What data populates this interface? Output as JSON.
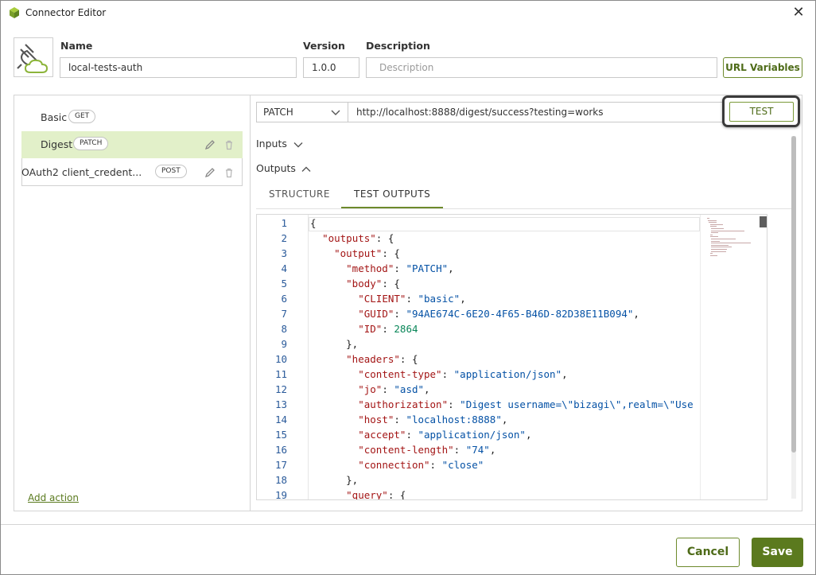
{
  "window": {
    "title": "Connector Editor"
  },
  "header": {
    "name_label": "Name",
    "name_value": "local-tests-auth",
    "version_label": "Version",
    "version_value": "1.0.0",
    "description_label": "Description",
    "description_placeholder": "Description",
    "url_variables_label": "URL Variables"
  },
  "actions": [
    {
      "name": "Basic",
      "method": "GET"
    },
    {
      "name": "Digest",
      "method": "PATCH"
    },
    {
      "name": "OAuth2 client_credent...",
      "method": "POST"
    }
  ],
  "add_action_label": "Add action",
  "request": {
    "method": "PATCH",
    "url": "http://localhost:8888/digest/success?testing=works",
    "test_label": "TEST"
  },
  "sections": {
    "inputs_label": "Inputs",
    "outputs_label": "Outputs"
  },
  "tabs": {
    "structure": "STRUCTURE",
    "test_outputs": "TEST OUTPUTS"
  },
  "editor": {
    "line_numbers": [
      "1",
      "2",
      "3",
      "4",
      "5",
      "6",
      "7",
      "8",
      "9",
      "10",
      "11",
      "12",
      "13",
      "14",
      "15",
      "16",
      "17",
      "18",
      "19"
    ],
    "lines": [
      [
        [
          "p",
          "{"
        ]
      ],
      [
        [
          "p",
          "  "
        ],
        [
          "k",
          "\"outputs\""
        ],
        [
          "p",
          ": {"
        ]
      ],
      [
        [
          "p",
          "    "
        ],
        [
          "k",
          "\"output\""
        ],
        [
          "p",
          ": {"
        ]
      ],
      [
        [
          "p",
          "      "
        ],
        [
          "k",
          "\"method\""
        ],
        [
          "p",
          ": "
        ],
        [
          "s",
          "\"PATCH\""
        ],
        [
          "p",
          ","
        ]
      ],
      [
        [
          "p",
          "      "
        ],
        [
          "k",
          "\"body\""
        ],
        [
          "p",
          ": {"
        ]
      ],
      [
        [
          "p",
          "        "
        ],
        [
          "k",
          "\"CLIENT\""
        ],
        [
          "p",
          ": "
        ],
        [
          "s",
          "\"basic\""
        ],
        [
          "p",
          ","
        ]
      ],
      [
        [
          "p",
          "        "
        ],
        [
          "k",
          "\"GUID\""
        ],
        [
          "p",
          ": "
        ],
        [
          "s",
          "\"94AE674C-6E20-4F65-B46D-82D38E11B094\""
        ],
        [
          "p",
          ","
        ]
      ],
      [
        [
          "p",
          "        "
        ],
        [
          "k",
          "\"ID\""
        ],
        [
          "p",
          ": "
        ],
        [
          "n",
          "2864"
        ]
      ],
      [
        [
          "p",
          "      },"
        ]
      ],
      [
        [
          "p",
          "      "
        ],
        [
          "k",
          "\"headers\""
        ],
        [
          "p",
          ": {"
        ]
      ],
      [
        [
          "p",
          "        "
        ],
        [
          "k",
          "\"content-type\""
        ],
        [
          "p",
          ": "
        ],
        [
          "s",
          "\"application/json\""
        ],
        [
          "p",
          ","
        ]
      ],
      [
        [
          "p",
          "        "
        ],
        [
          "k",
          "\"jo\""
        ],
        [
          "p",
          ": "
        ],
        [
          "s",
          "\"asd\""
        ],
        [
          "p",
          ","
        ]
      ],
      [
        [
          "p",
          "        "
        ],
        [
          "k",
          "\"authorization\""
        ],
        [
          "p",
          ": "
        ],
        [
          "s",
          "\"Digest username=\\\"bizagi\\\",realm=\\\"Use"
        ]
      ],
      [
        [
          "p",
          "        "
        ],
        [
          "k",
          "\"host\""
        ],
        [
          "p",
          ": "
        ],
        [
          "s",
          "\"localhost:8888\""
        ],
        [
          "p",
          ","
        ]
      ],
      [
        [
          "p",
          "        "
        ],
        [
          "k",
          "\"accept\""
        ],
        [
          "p",
          ": "
        ],
        [
          "s",
          "\"application/json\""
        ],
        [
          "p",
          ","
        ]
      ],
      [
        [
          "p",
          "        "
        ],
        [
          "k",
          "\"content-length\""
        ],
        [
          "p",
          ": "
        ],
        [
          "s",
          "\"74\""
        ],
        [
          "p",
          ","
        ]
      ],
      [
        [
          "p",
          "        "
        ],
        [
          "k",
          "\"connection\""
        ],
        [
          "p",
          ": "
        ],
        [
          "s",
          "\"close\""
        ]
      ],
      [
        [
          "p",
          "      },"
        ]
      ],
      [
        [
          "p",
          "      "
        ],
        [
          "k",
          "\"query\""
        ],
        [
          "p",
          ": {"
        ]
      ]
    ]
  },
  "footer": {
    "cancel_label": "Cancel",
    "save_label": "Save"
  },
  "colors": {
    "accent": "#5b7a1e",
    "selected_row": "#e2f0c9",
    "json_key": "#a31515",
    "json_string": "#0451a5",
    "json_number": "#098658"
  },
  "icons": {
    "app": "cube-icon",
    "close": "close-icon",
    "connector": "plug-cloud-icon",
    "edit": "pencil-icon",
    "delete": "trash-icon",
    "expand": "chevron-down-icon",
    "collapse": "chevron-up-icon"
  }
}
